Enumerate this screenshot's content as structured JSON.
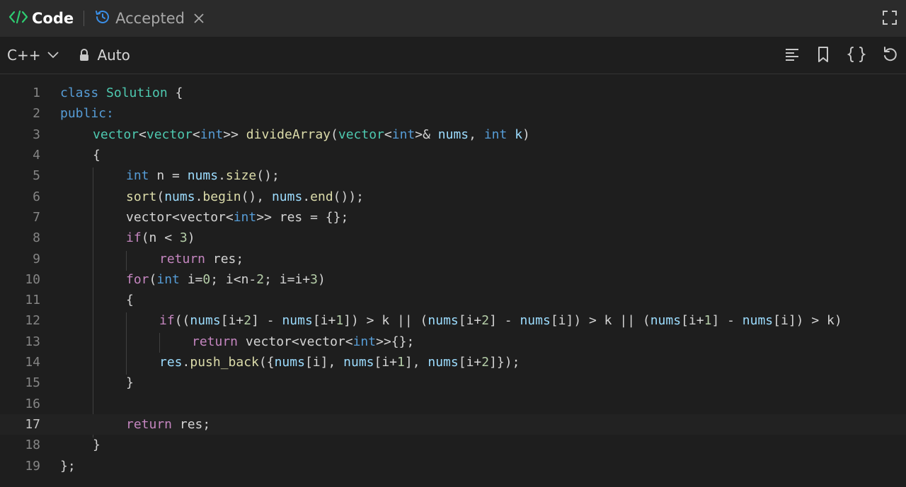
{
  "tabs": {
    "code_label": "Code",
    "accepted_label": "Accepted"
  },
  "toolbar": {
    "language": "C++",
    "mode": "Auto"
  },
  "editor": {
    "active_line": 17,
    "line_numbers": [
      "1",
      "2",
      "3",
      "4",
      "5",
      "6",
      "7",
      "8",
      "9",
      "10",
      "11",
      "12",
      "13",
      "14",
      "15",
      "16",
      "17",
      "18",
      "19"
    ],
    "code": {
      "l1_class": "class",
      "l1_name": "Solution",
      "l1_brace": " {",
      "l2_public": "public:",
      "l3_vector1": "vector",
      "l3_lt1": "<",
      "l3_vector2": "vector",
      "l3_lt2": "<",
      "l3_int1": "int",
      "l3_gt": ">>",
      "l3_fname": "divideArray",
      "l3_paren": "(",
      "l3_vector3": "vector",
      "l3_lt3": "<",
      "l3_int2": "int",
      "l3_amp": ">&",
      "l3_nums": "nums",
      "l3_comma": ", ",
      "l3_int3": "int",
      "l3_k": "k",
      "l3_close": ")",
      "l4": "{",
      "l5_int": "int",
      "l5_rest1": " n = ",
      "l5_nums": "nums",
      "l5_dot": ".",
      "l5_size": "size",
      "l5_end": "();",
      "l6_sort": "sort",
      "l6_p": "(",
      "l6_nums1": "nums",
      "l6_dot1": ".",
      "l6_begin": "begin",
      "l6_mid": "(), ",
      "l6_nums2": "nums",
      "l6_dot2": ".",
      "l6_endfn": "end",
      "l6_close": "());",
      "l7_a": "vector<vector<",
      "l7_int": "int",
      "l7_b": ">> res = {};",
      "l8_if": "if",
      "l8_a": "(n < ",
      "l8_3": "3",
      "l8_b": ")",
      "l9_return": "return",
      "l9_rest": " res;",
      "l10_for": "for",
      "l10_a": "(",
      "l10_int": "int",
      "l10_b": " i=",
      "l10_0": "0",
      "l10_c": "; i<n-",
      "l10_2": "2",
      "l10_d": "; i=i+",
      "l10_3": "3",
      "l10_e": ")",
      "l11": "{",
      "l12_if": "if",
      "l12_a": "((",
      "l12_n1": "nums",
      "l12_b": "[i+",
      "l12_2a": "2",
      "l12_c": "] - ",
      "l12_n2": "nums",
      "l12_d": "[i+",
      "l12_1a": "1",
      "l12_e": "]) > k || (",
      "l12_n3": "nums",
      "l12_f": "[i+",
      "l12_2b": "2",
      "l12_g": "] - ",
      "l12_n4": "nums",
      "l12_h": "[i]) > k || (",
      "l12_n5": "nums",
      "l12_i": "[i+",
      "l12_1b": "1",
      "l12_j": "] - ",
      "l12_n6": "nums",
      "l12_k": "[i]) > k)",
      "l13_return": "return",
      "l13_a": " vector<vector<",
      "l13_int": "int",
      "l13_b": ">>{};",
      "l14_res": "res",
      "l14_dot": ".",
      "l14_push": "push_back",
      "l14_a": "({",
      "l14_n1": "nums",
      "l14_b": "[i], ",
      "l14_n2": "nums",
      "l14_c": "[i+",
      "l14_1": "1",
      "l14_d": "], ",
      "l14_n3": "nums",
      "l14_e": "[i+",
      "l14_2": "2",
      "l14_f": "]});",
      "l15": "}",
      "l17_return": "return",
      "l17_rest": " res;",
      "l18": "}",
      "l19": "};"
    }
  },
  "colors": {
    "keyword": "#569cd6",
    "type": "#4ec9b0",
    "function": "#dcdcaa",
    "variable": "#9cdcfe",
    "number": "#b5cea8",
    "control": "#c586c0",
    "accent_green": "#2ecc71",
    "accent_blue": "#3a8ee6"
  },
  "icons": {
    "code_tab": "code-brackets-icon",
    "accepted_tab": "history-icon",
    "close": "close-icon",
    "fullscreen": "fullscreen-icon",
    "language_dropdown": "chevron-down-icon",
    "auto_lock": "lock-icon",
    "format": "align-left-icon",
    "bookmark": "bookmark-icon",
    "braces": "braces-icon",
    "reset": "reset-icon"
  }
}
